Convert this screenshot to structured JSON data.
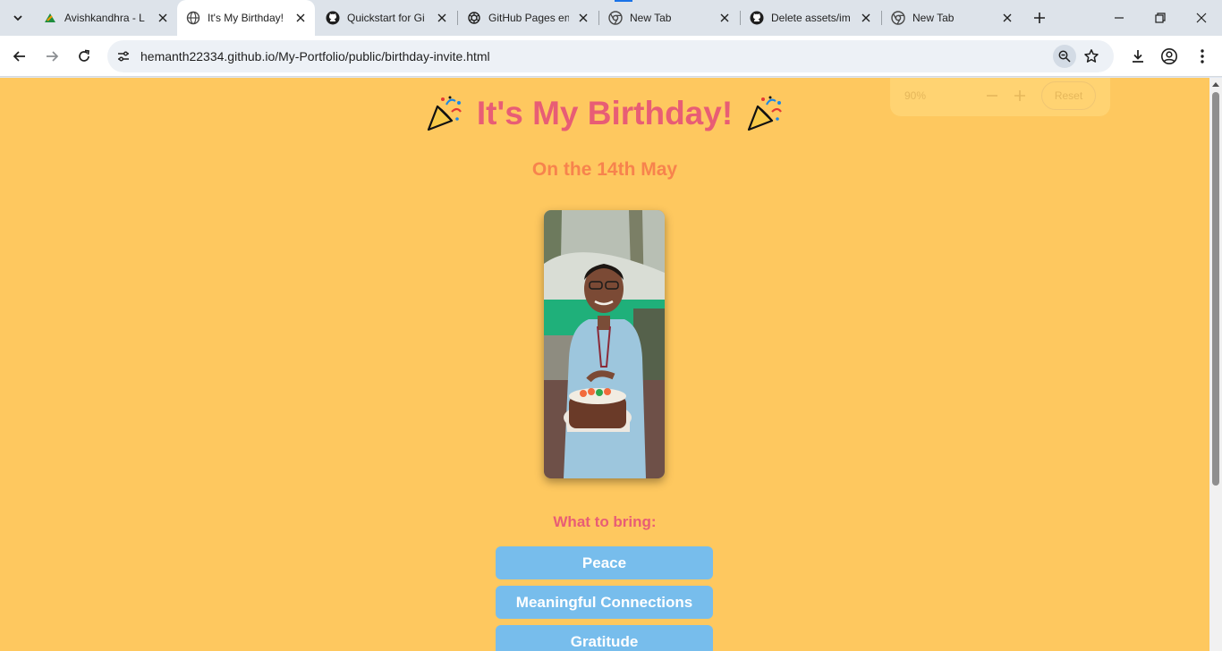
{
  "browser": {
    "tabs": [
      {
        "title": "Avishkandhra - L",
        "icon": "avishkandhra-icon"
      },
      {
        "title": "It's My Birthday!",
        "icon": "globe-icon"
      },
      {
        "title": "Quickstart for Gi",
        "icon": "github-icon"
      },
      {
        "title": "GitHub Pages en",
        "icon": "openai-icon"
      },
      {
        "title": "New Tab",
        "icon": "chrome-icon"
      },
      {
        "title": "Delete assets/im",
        "icon": "github-icon"
      },
      {
        "title": "New Tab",
        "icon": "chrome-icon"
      }
    ],
    "url": "hemanth22334.github.io/My-Portfolio/public/birthday-invite.html",
    "accent_color": "#1a73e8"
  },
  "zoom": {
    "percent": "90%",
    "reset_label": "Reset"
  },
  "page": {
    "title": "It's My Birthday!",
    "date": "On the 14th May",
    "bring_label": "What to bring:",
    "bring_items": [
      "Peace",
      "Meaningful Connections",
      "Gratitude"
    ],
    "colors": {
      "background": "#fec85f",
      "title": "#e85d75",
      "date": "#f7834d",
      "button": "#77bdec"
    }
  }
}
